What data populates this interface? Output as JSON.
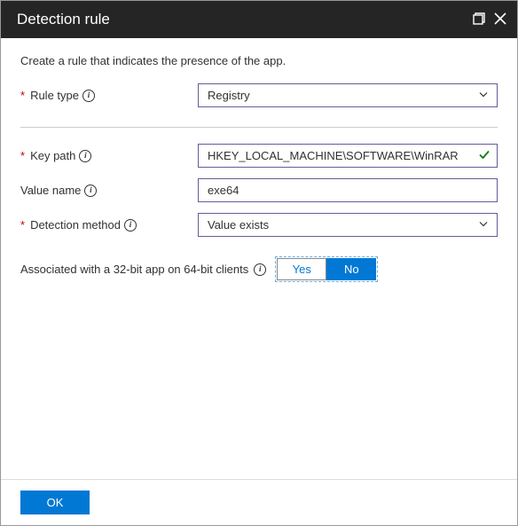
{
  "header": {
    "title": "Detection rule"
  },
  "intro": "Create a rule that indicates the presence of the app.",
  "fields": {
    "ruleType": {
      "label": "Rule type",
      "value": "Registry",
      "required": true
    },
    "keyPath": {
      "label": "Key path",
      "value": "HKEY_LOCAL_MACHINE\\SOFTWARE\\WinRAR",
      "required": true
    },
    "valueName": {
      "label": "Value name",
      "value": "exe64",
      "required": false
    },
    "detectionMethod": {
      "label": "Detection method",
      "value": "Value exists",
      "required": true
    }
  },
  "toggle": {
    "label": "Associated with a 32-bit app on 64-bit clients",
    "options": {
      "yes": "Yes",
      "no": "No"
    },
    "selected": "no"
  },
  "footer": {
    "ok": "OK"
  }
}
